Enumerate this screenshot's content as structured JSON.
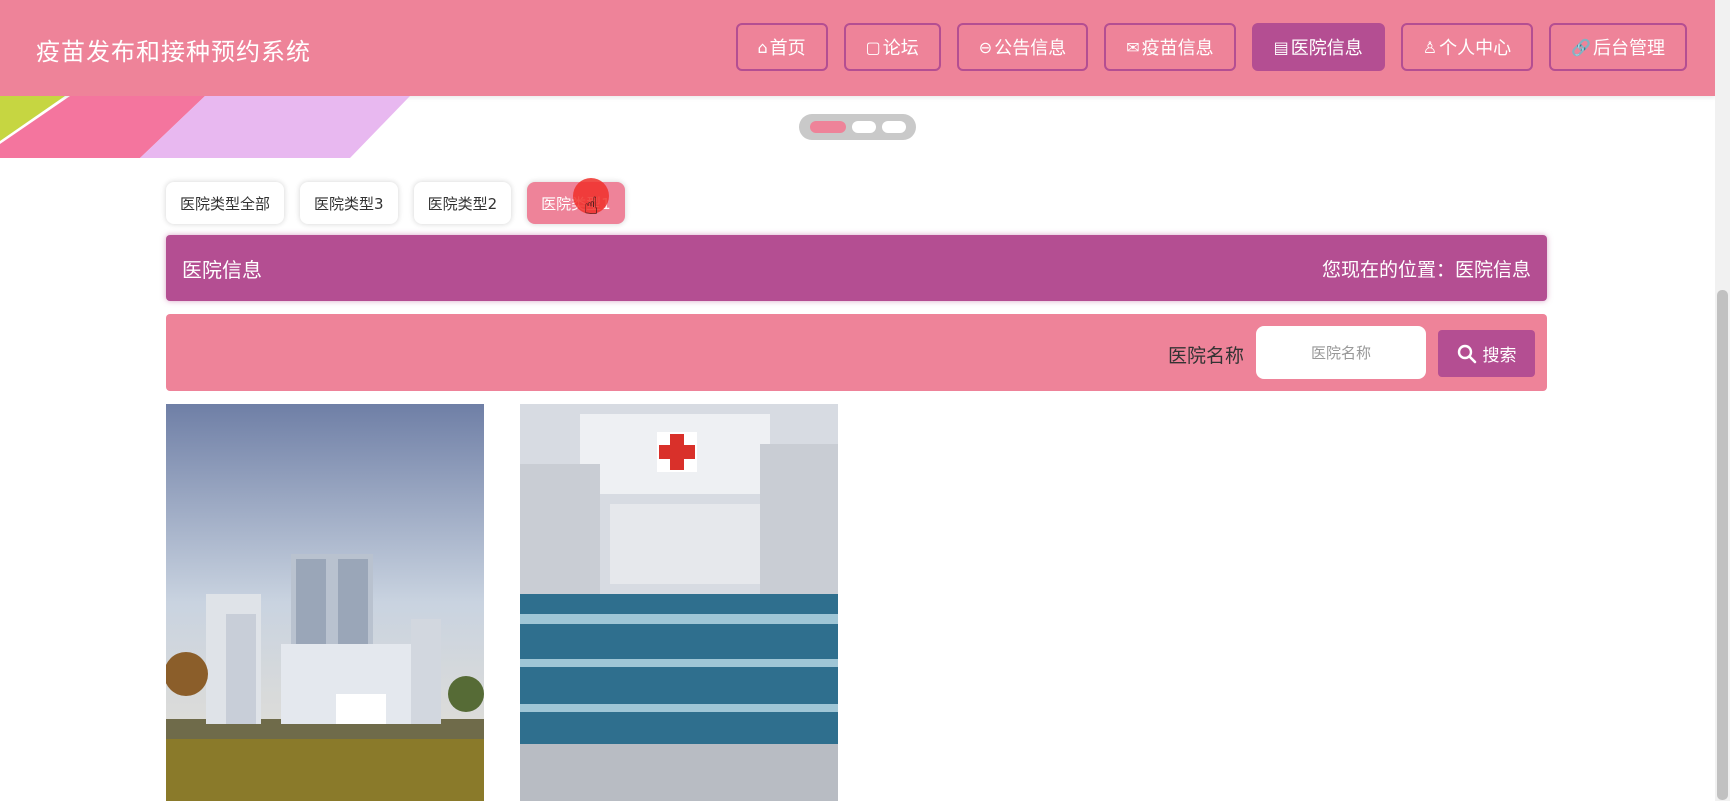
{
  "site_title": "疫苗发布和接种预约系统",
  "nav": [
    {
      "icon": "home-icon",
      "glyph": "⌂",
      "label": "首页",
      "active": false
    },
    {
      "icon": "forum-icon",
      "glyph": "▢",
      "label": "论坛",
      "active": false
    },
    {
      "icon": "announcement-icon",
      "glyph": "⊖",
      "label": "公告信息",
      "active": false
    },
    {
      "icon": "mail-icon",
      "glyph": "✉",
      "label": "疫苗信息",
      "active": false
    },
    {
      "icon": "clipboard-icon",
      "glyph": "▤",
      "label": "医院信息",
      "active": true
    },
    {
      "icon": "user-icon",
      "glyph": "♙",
      "label": "个人中心",
      "active": false
    },
    {
      "icon": "link-icon",
      "glyph": "🔗",
      "label": "后台管理",
      "active": false
    }
  ],
  "categories": [
    {
      "label": "医院类型全部",
      "active": false
    },
    {
      "label": "医院类型3",
      "active": false
    },
    {
      "label": "医院类型2",
      "active": false
    },
    {
      "label": "医院类型1",
      "active": true
    }
  ],
  "breadcrumb": {
    "title": "医院信息",
    "location": "您现在的位置：医院信息"
  },
  "search": {
    "label": "医院名称",
    "placeholder": "医院名称",
    "button": "搜索"
  },
  "colors": {
    "primary_pink": "#ee8399",
    "accent_purple": "#b44e92"
  }
}
